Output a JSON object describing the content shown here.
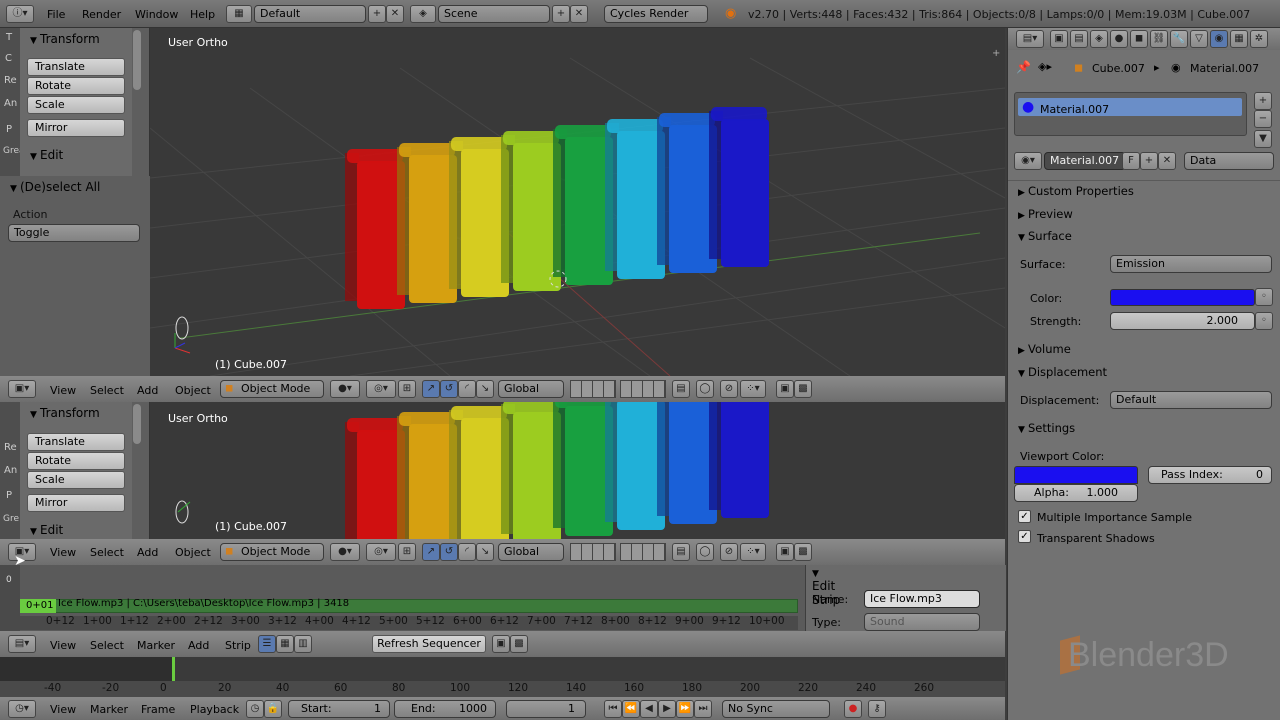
{
  "topbar": {
    "menu": [
      "File",
      "Render",
      "Window",
      "Help"
    ],
    "layout": "Default",
    "scene": "Scene",
    "engine": "Cycles Render",
    "stats": "v2.70 | Verts:448 | Faces:432 | Tris:864 | Objects:0/8 | Lamps:0/0 | Mem:19.03M | Cube.007"
  },
  "tool_shelf": {
    "transform": "Transform",
    "buttons": [
      "Translate",
      "Rotate",
      "Scale"
    ],
    "mirror": "Mirror",
    "edit": "Edit",
    "deselect": "(De)select All",
    "action_label": "Action",
    "action_value": "Toggle",
    "tabs": [
      "T",
      "C",
      "Re",
      "An",
      "P",
      "Grea"
    ]
  },
  "tool_shelf2": {
    "tabs": [
      "Re",
      "An",
      "P",
      "Gre"
    ]
  },
  "viewport": {
    "label": "User Ortho",
    "object": "(1) Cube.007"
  },
  "viewport_header": {
    "menu": [
      "View",
      "Select",
      "Add",
      "Object"
    ],
    "mode": "Object Mode",
    "orientation": "Global"
  },
  "seq": {
    "strip_start": "0+01",
    "strip_text": "Ice Flow.mp3 | C:\\Users\\teba\\Desktop\\Ice Flow.mp3 | 3418",
    "ticks": [
      "0+12",
      "1+00",
      "1+12",
      "2+00",
      "2+12",
      "3+00",
      "3+12",
      "4+00",
      "4+12",
      "5+00",
      "5+12",
      "6+00",
      "6+12",
      "7+00",
      "7+12",
      "8+00",
      "8+12",
      "9+00",
      "9+12",
      "10+00"
    ],
    "edit_strip": "Edit Strip",
    "name_label": "Name:",
    "name_value": "Ice Flow.mp3",
    "type_label": "Type:",
    "type_value": "Sound"
  },
  "seq_header": {
    "menu": [
      "View",
      "Select",
      "Marker",
      "Add",
      "Strip"
    ],
    "refresh": "Refresh Sequencer"
  },
  "timeline": {
    "ticks": [
      "-40",
      "-20",
      "0",
      "20",
      "40",
      "60",
      "80",
      "100",
      "120",
      "140",
      "160",
      "180",
      "200",
      "220",
      "240",
      "260"
    ]
  },
  "timeline_header": {
    "menu": [
      "View",
      "Marker",
      "Frame",
      "Playback"
    ],
    "start_label": "Start:",
    "start_value": "1",
    "end_label": "End:",
    "end_value": "1000",
    "current": "1",
    "sync": "No Sync"
  },
  "properties": {
    "crumb_obj": "Cube.007",
    "crumb_mat": "Material.007",
    "material_slot": "Material.007",
    "mat_name": "Material.007",
    "f_btn": "F",
    "link": "Data",
    "custom": "Custom Properties",
    "preview": "Preview",
    "surface": "Surface",
    "surface_label": "Surface:",
    "surface_value": "Emission",
    "color_label": "Color:",
    "strength_label": "Strength:",
    "strength_value": "2.000",
    "volume": "Volume",
    "displacement": "Displacement",
    "displacement_label": "Displacement:",
    "displacement_value": "Default",
    "settings": "Settings",
    "viewport_color": "Viewport Color:",
    "pass_index": "Pass Index:",
    "pass_value": "0",
    "alpha_label": "Alpha:",
    "alpha_value": "1.000",
    "mis": "Multiple Importance Sample",
    "transparent": "Transparent Shadows"
  },
  "watermark": "Blender3D",
  "colors": {
    "material": "#1a0ff0",
    "cubes": [
      "#d01010",
      "#d6a010",
      "#d6cc20",
      "#9ccc20",
      "#18a040",
      "#20b0d8",
      "#1a60d8",
      "#1a18c8"
    ]
  }
}
